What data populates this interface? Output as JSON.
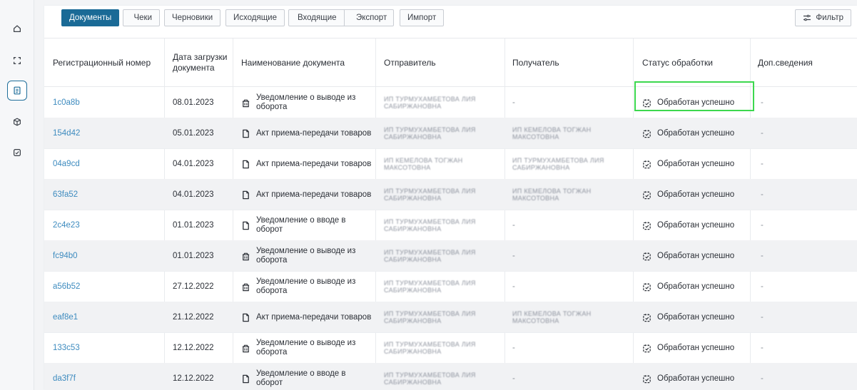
{
  "sidebar": {
    "items": [
      {
        "icon": "home-icon",
        "active": false
      },
      {
        "icon": "scan-frame-icon",
        "active": false
      },
      {
        "icon": "document-icon",
        "active": true
      },
      {
        "icon": "box-icon",
        "active": false
      },
      {
        "icon": "check-square-icon",
        "active": false
      }
    ]
  },
  "tabs": {
    "documents": "Документы",
    "receipts": "Чеки",
    "drafts": "Черновики",
    "outgoing": "Исходящие",
    "incoming": "Входящие",
    "export": "Экспорт",
    "import": "Импорт",
    "filter": "Фильтр"
  },
  "table": {
    "headers": {
      "reg": "Регистрационный номер",
      "date": "Дата загрузки документа",
      "name": "Наименование документа",
      "sender": "Отправитель",
      "receiver": "Получатель",
      "status": "Статус обработки",
      "extra": "Доп.сведения"
    },
    "rows": [
      {
        "reg": "1c0a8b",
        "date": "08.01.2023",
        "doc_icon": "withdraw-icon",
        "name": "Уведомление о выводе из оборота",
        "sender": "ИП ТУРМУХАМБЕТОВА ЛИЯ САБИРЖАНОВНА",
        "receiver": "-",
        "status": "Обработан успешно",
        "extra": "-"
      },
      {
        "reg": "154d42",
        "date": "05.01.2023",
        "doc_icon": "file-icon",
        "name": "Акт приема-передачи товаров",
        "sender": "ИП ТУРМУХАМБЕТОВА ЛИЯ САБИРЖАНОВНА",
        "receiver": "ИП КЕМЕЛОВА ТОГЖАН МАКСОТОВНА",
        "status": "Обработан успешно",
        "extra": "-"
      },
      {
        "reg": "04a9cd",
        "date": "04.01.2023",
        "doc_icon": "file-icon",
        "name": "Акт приема-передачи товаров",
        "sender": "ИП КЕМЕЛОВА ТОГЖАН МАКСОТОВНА",
        "receiver": "ИП ТУРМУХАМБЕТОВА ЛИЯ САБИРЖАНОВНА",
        "status": "Обработан успешно",
        "extra": "-"
      },
      {
        "reg": "63fa52",
        "date": "04.01.2023",
        "doc_icon": "file-icon",
        "name": "Акт приема-передачи товаров",
        "sender": "ИП ТУРМУХАМБЕТОВА ЛИЯ САБИРЖАНОВНА",
        "receiver": "ИП КЕМЕЛОВА ТОГЖАН МАКСОТОВНА",
        "status": "Обработан успешно",
        "extra": "-"
      },
      {
        "reg": "2c4e23",
        "date": "01.01.2023",
        "doc_icon": "file-icon",
        "name": "Уведомление о вводе в оборот",
        "sender": "ИП ТУРМУХАМБЕТОВА ЛИЯ САБИРЖАНОВНА",
        "receiver": "-",
        "status": "Обработан успешно",
        "extra": "-"
      },
      {
        "reg": "fc94b0",
        "date": "01.01.2023",
        "doc_icon": "withdraw-icon",
        "name": "Уведомление о выводе из оборота",
        "sender": "ИП ТУРМУХАМБЕТОВА ЛИЯ САБИРЖАНОВНА",
        "receiver": "-",
        "status": "Обработан успешно",
        "extra": "-"
      },
      {
        "reg": "a56b52",
        "date": "27.12.2022",
        "doc_icon": "withdraw-icon",
        "name": "Уведомление о выводе из оборота",
        "sender": "ИП ТУРМУХАМБЕТОВА ЛИЯ САБИРЖАНОВНА",
        "receiver": "-",
        "status": "Обработан успешно",
        "extra": "-"
      },
      {
        "reg": "eaf8e1",
        "date": "21.12.2022",
        "doc_icon": "file-icon",
        "name": "Акт приема-передачи товаров",
        "sender": "ИП ТУРМУХАМБЕТОВА ЛИЯ САБИРЖАНОВНА",
        "receiver": "ИП КЕМЕЛОВА ТОГЖАН МАКСОТОВНА",
        "status": "Обработан успешно",
        "extra": "-"
      },
      {
        "reg": "133c53",
        "date": "12.12.2022",
        "doc_icon": "withdraw-icon",
        "name": "Уведомление о выводе из оборота",
        "sender": "ИП ТУРМУХАМБЕТОВА ЛИЯ САБИРЖАНОВНА",
        "receiver": "-",
        "status": "Обработан успешно",
        "extra": "-"
      },
      {
        "reg": "da3f7f",
        "date": "12.12.2022",
        "doc_icon": "file-icon",
        "name": "Уведомление о вводе в оборот",
        "sender": "ИП ТУРМУХАМБЕТОВА ЛИЯ САБИРЖАНОВНА",
        "receiver": "-",
        "status": "Обработан успешно",
        "extra": "-"
      }
    ]
  },
  "colors": {
    "accent": "#1a6a96",
    "link": "#3d8bbf",
    "highlight": "#3cd84e"
  }
}
